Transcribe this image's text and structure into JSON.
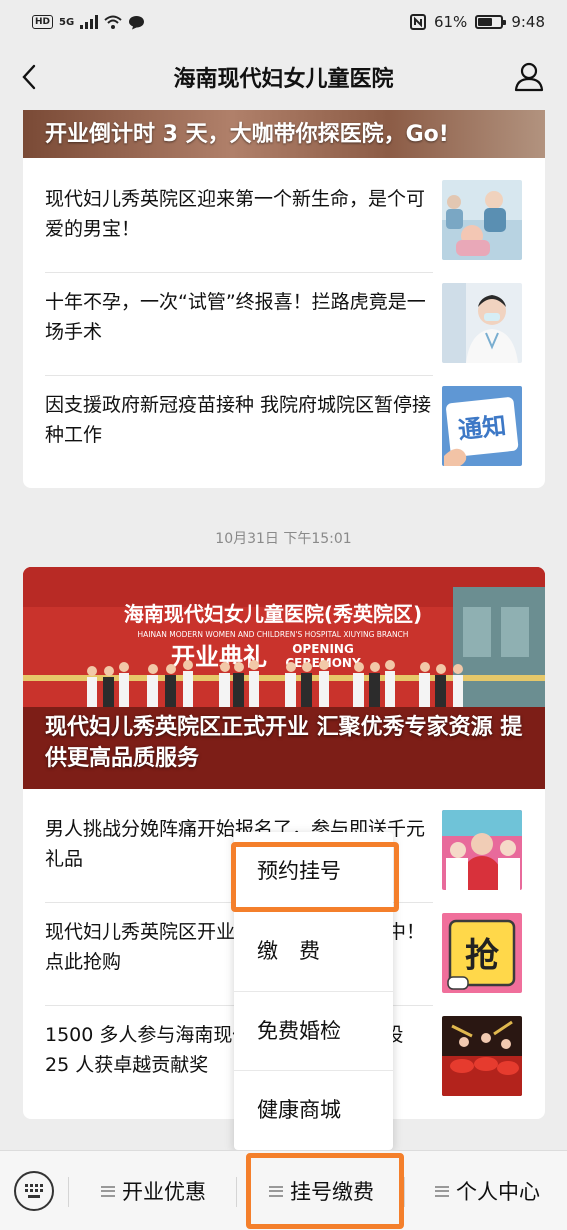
{
  "status_bar": {
    "hd": "HD",
    "network": "5G",
    "battery_percent": "61%",
    "battery_level": 0.61,
    "time": "9:48"
  },
  "nav": {
    "title": "海南现代妇女儿童医院"
  },
  "card1": {
    "banner_title": "开业倒计时 3 天，大咖带你探医院，Go!",
    "articles": [
      {
        "title": "现代妇儿秀英院区迎来第一个新生命，是个可爱的男宝！",
        "thumb": "newborn-photo"
      },
      {
        "title": "十年不孕，一次“试管”终报喜！拦路虎竟是一场手术",
        "thumb": "doctor-photo"
      },
      {
        "title": "因支援政府新冠疫苗接种 我院府城院区暂停接种工作",
        "thumb": "notice-icon",
        "thumb_text": "通知"
      }
    ]
  },
  "timestamp": "10月31日 下午15:01",
  "card2": {
    "hero_title": "现代妇儿秀英院区正式开业 汇聚优秀专家资源 提供更高品质服务",
    "hero_sign": {
      "line1": "海南现代妇女儿童医院(秀英院区)",
      "line2": "HAINAN MODERN WOMEN AND CHILDREN'S HOSPITAL XIUYING BRANCH",
      "line3": "开业典礼",
      "line4": "OPENING",
      "line5": "CEREMONY"
    },
    "articles": [
      {
        "title": "男人挑战分娩阵痛开始报名了，参与即送千元礼品",
        "thumb": "event-photo"
      },
      {
        "title": "现代妇儿秀英院区开业优惠活动火热进行中！点此抢购",
        "thumb": "grab-icon",
        "thumb_text": "抢"
      },
      {
        "title": "1500 多人参与海南现代妇儿秀英院区建设 25 人获卓越贡献奖",
        "thumb": "drum-photo"
      }
    ]
  },
  "popup_menu": {
    "items": [
      "预约挂号",
      "缴　费",
      "免费婚检",
      "健康商城"
    ],
    "highlighted": "预约挂号"
  },
  "bottom_menu": {
    "items": [
      "开业优惠",
      "挂号缴费",
      "个人中心"
    ],
    "active": "挂号缴费"
  },
  "colors": {
    "highlight": "#f47f2b",
    "background": "#ededed"
  }
}
